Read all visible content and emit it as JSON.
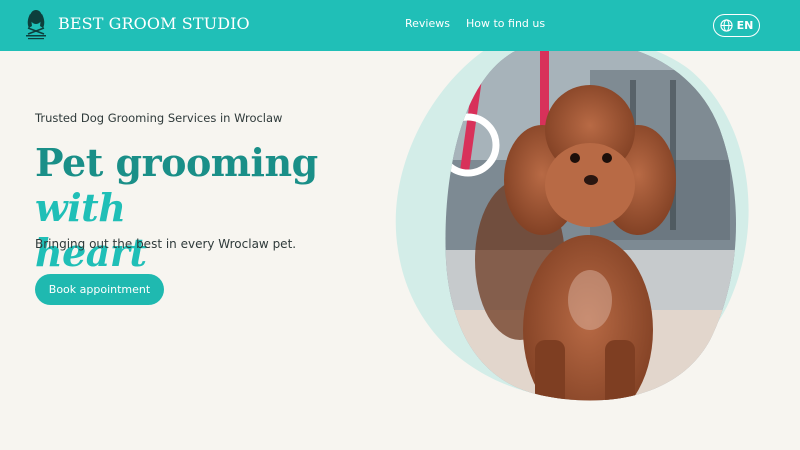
{
  "header": {
    "brand": "BEST GROOM STUDIO",
    "nav": [
      {
        "label": "Reviews"
      },
      {
        "label": "How to find us"
      }
    ],
    "language": {
      "label": "EN",
      "icon": "globe-icon"
    }
  },
  "hero": {
    "tagline": "Trusted Dog Grooming Services in Wroclaw",
    "headline_main": "Pet grooming ",
    "headline_accent_1": "with",
    "headline_accent_2": "heart",
    "subheading": "Bringing out the best in every Wroclaw pet.",
    "cta_label": "Book appointment"
  },
  "colors": {
    "accent": "#20bfb7",
    "heading": "#1a8f88",
    "background": "#f7f5f0",
    "blob": "#d3ede8"
  }
}
